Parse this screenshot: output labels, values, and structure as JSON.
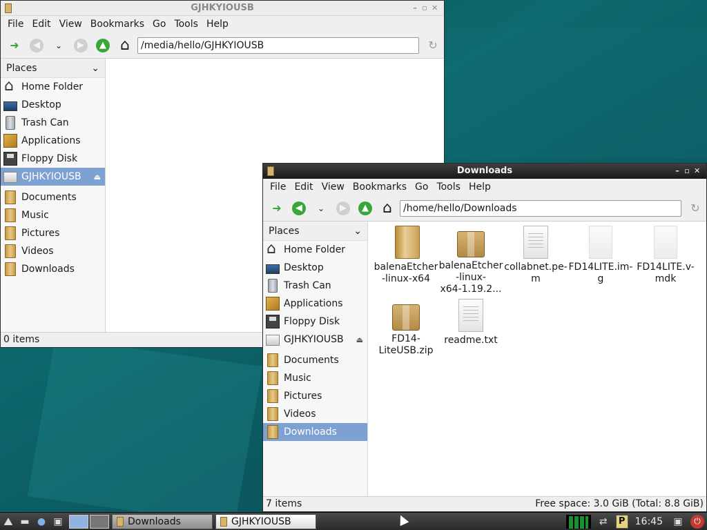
{
  "colors": {
    "selection": "#7ea1d3",
    "accent_green": "#3aa63a",
    "desktop": "#0d6a6e"
  },
  "menu": [
    "File",
    "Edit",
    "View",
    "Bookmarks",
    "Go",
    "Tools",
    "Help"
  ],
  "places_label": "Places",
  "window_usb": {
    "title": "GJHKYIOUSB",
    "path": "/media/hello/GJHKYIOUSB",
    "places": [
      {
        "label": "Home Folder"
      },
      {
        "label": "Desktop"
      },
      {
        "label": "Trash Can"
      },
      {
        "label": "Applications"
      },
      {
        "label": "Floppy Disk"
      },
      {
        "label": "GJHKYIOUSB"
      },
      {
        "label": "Documents"
      },
      {
        "label": "Music"
      },
      {
        "label": "Pictures"
      },
      {
        "label": "Videos"
      },
      {
        "label": "Downloads"
      }
    ],
    "status": "0 items"
  },
  "window_downloads": {
    "title": "Downloads",
    "path": "/home/hello/Downloads",
    "places": [
      {
        "label": "Home Folder"
      },
      {
        "label": "Desktop"
      },
      {
        "label": "Trash Can"
      },
      {
        "label": "Applications"
      },
      {
        "label": "Floppy Disk"
      },
      {
        "label": "GJHKYIOUSB"
      },
      {
        "label": "Documents"
      },
      {
        "label": "Music"
      },
      {
        "label": "Pictures"
      },
      {
        "label": "Videos"
      },
      {
        "label": "Downloads"
      }
    ],
    "files": [
      {
        "name": "balenaEtcher\n-linux-x64",
        "icon": "folder-icon"
      },
      {
        "name": "balenaEtcher\n-linux-\nx64-1.19.2...",
        "icon": "archive-icon"
      },
      {
        "name": "collabnet.pe-\nm",
        "icon": "document-icon"
      },
      {
        "name": "FD14LITE.im-\ng",
        "icon": "blank-file-icon"
      },
      {
        "name": "FD14LITE.v-\nmdk",
        "icon": "blank-file-icon"
      },
      {
        "name": "FD14-\nLiteUSB.zip",
        "icon": "archive-icon"
      },
      {
        "name": "readme.txt",
        "icon": "document-icon"
      }
    ],
    "status_left": "7 items",
    "status_right": "Free space: 3.0 GiB (Total: 8.8 GiB)"
  },
  "taskbar": {
    "tasks": [
      {
        "label": "Downloads"
      },
      {
        "label": "GJHKYIOUSB"
      }
    ],
    "clock": "16:45",
    "tray_badge": "P"
  }
}
